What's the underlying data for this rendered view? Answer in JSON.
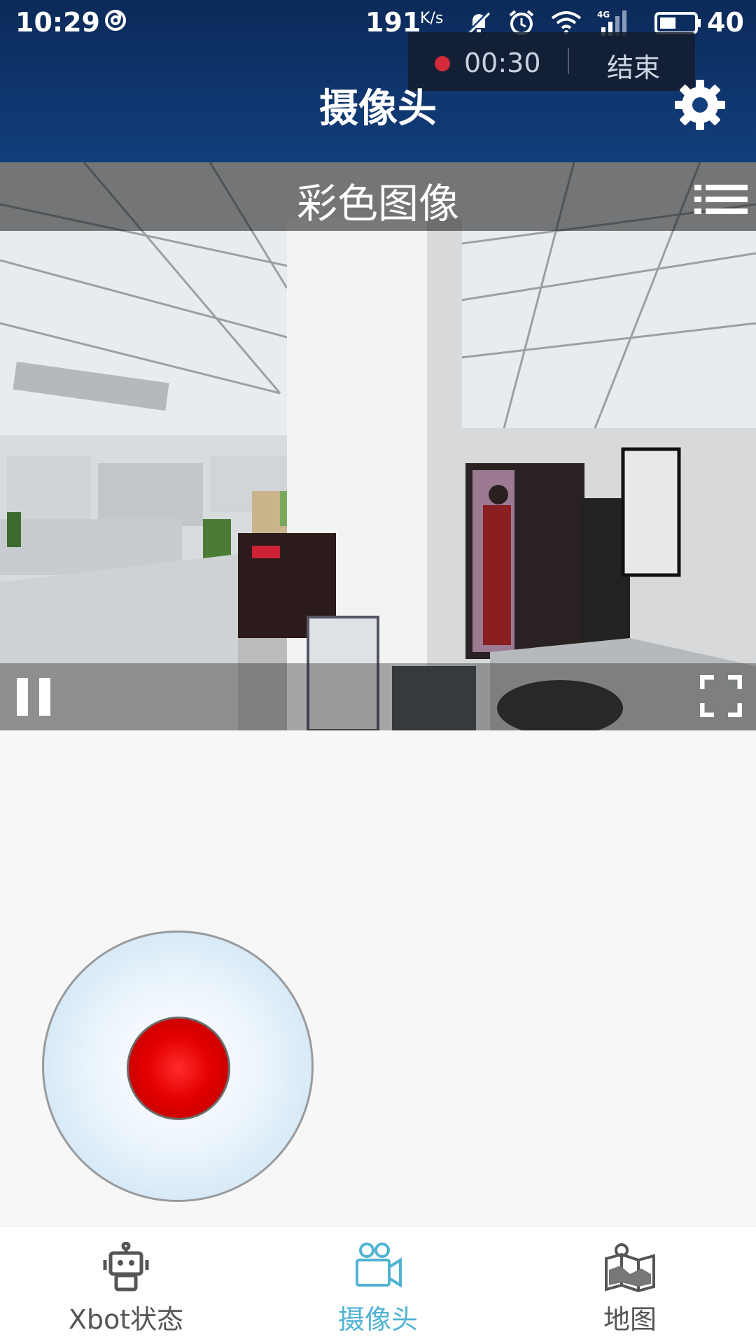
{
  "status_bar": {
    "time": "10:29",
    "net_speed": "191",
    "net_speed_unit": "K/s",
    "network": "4G",
    "battery_level": "40",
    "icons": [
      "hotspot-ring-icon",
      "bell-off-icon",
      "alarm-icon",
      "wifi-icon",
      "cell-signal-icon",
      "battery-icon"
    ]
  },
  "recording": {
    "elapsed": "00:30",
    "end_label": "结束"
  },
  "header": {
    "title": "摄像头",
    "settings_icon": "gear-icon"
  },
  "camera": {
    "mode_title": "彩色图像",
    "menu_icon": "list-icon",
    "pause_icon": "pause-icon",
    "fullscreen_icon": "fullscreen-icon"
  },
  "joystick": {
    "base_color": "#c3def3",
    "knob_color": "#e40000"
  },
  "bottom_nav": {
    "items": [
      {
        "label": "Xbot状态",
        "icon": "robot-icon",
        "active": false
      },
      {
        "label": "摄像头",
        "icon": "video-camera-icon",
        "active": true
      },
      {
        "label": "地图",
        "icon": "map-icon",
        "active": false
      }
    ],
    "active_color": "#4fb3d3"
  }
}
